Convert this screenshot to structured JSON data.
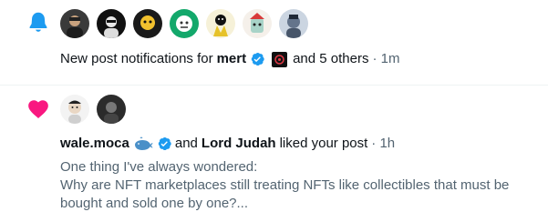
{
  "notifications": [
    {
      "type": "new_post",
      "icon": "bell-icon",
      "icon_color": "#1d9bf0",
      "avatars": [
        "avatar-1",
        "avatar-2",
        "avatar-3",
        "avatar-4",
        "avatar-5",
        "avatar-6"
      ],
      "text_prefix": "New post notifications for",
      "user": "mert",
      "others": "and 5 others",
      "time": "· 1m"
    },
    {
      "type": "like",
      "icon": "heart-icon",
      "icon_color": "#f91880",
      "avatars": [
        "avatar-wale",
        "avatar-judah"
      ],
      "user1": "wale.moca",
      "conjunction": "and",
      "user2": "Lord Judah",
      "action": "liked your post",
      "time": "· 1h",
      "post_lines": [
        "One thing I've always wondered:",
        "Why are NFT marketplaces still treating NFTs like collectibles that must be",
        "bought and sold one by one?..."
      ]
    }
  ],
  "colors": {
    "verified": "#1d9bf0",
    "text": "#0f1419",
    "muted": "#536471",
    "divider": "#eff3f4"
  }
}
